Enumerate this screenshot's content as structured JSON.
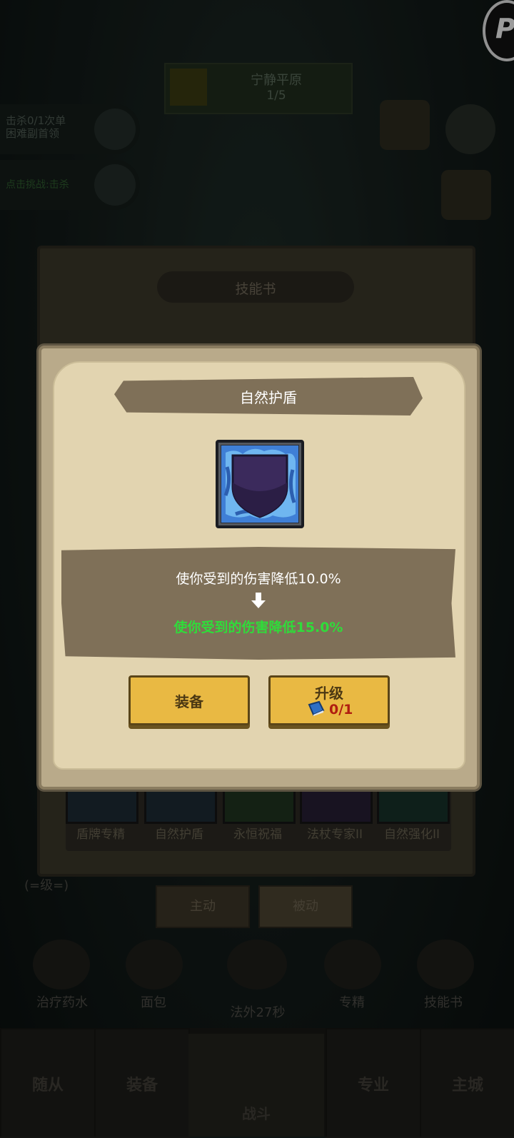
{
  "hud": {
    "resource_title": "宁静平原",
    "resource_count": "1/5",
    "corner_logo": "P"
  },
  "quests": {
    "quest1_line1": "击杀0/1次单",
    "quest1_line2": "困难副首领",
    "quest2": "点击挑战:击杀"
  },
  "book_panel": {
    "title": "技能书",
    "skills": [
      "盾牌专精",
      "自然护盾",
      "永恒祝福",
      "法杖专家II",
      "自然强化II"
    ]
  },
  "level_text": "(=级=)",
  "tabs": {
    "active": "主动",
    "passive": "被动"
  },
  "actions": [
    "治疗药水",
    "面包",
    "",
    "专精",
    "技能书"
  ],
  "action_center": "法外27秒",
  "nav": [
    "随从",
    "装备",
    "战斗",
    "专业",
    "主城"
  ],
  "popup": {
    "title": "自然护盾",
    "icon": "shield-icon",
    "current_effect": "使你受到的伤害降低10.0%",
    "next_effect": "使你受到的伤害降低15.0%",
    "equip_label": "装备",
    "upgrade_label": "升级",
    "upgrade_cost": "0/1",
    "colors": {
      "next_effect": "#2fdc3a",
      "button": "#e9b943",
      "cost": "#b01e10"
    }
  }
}
